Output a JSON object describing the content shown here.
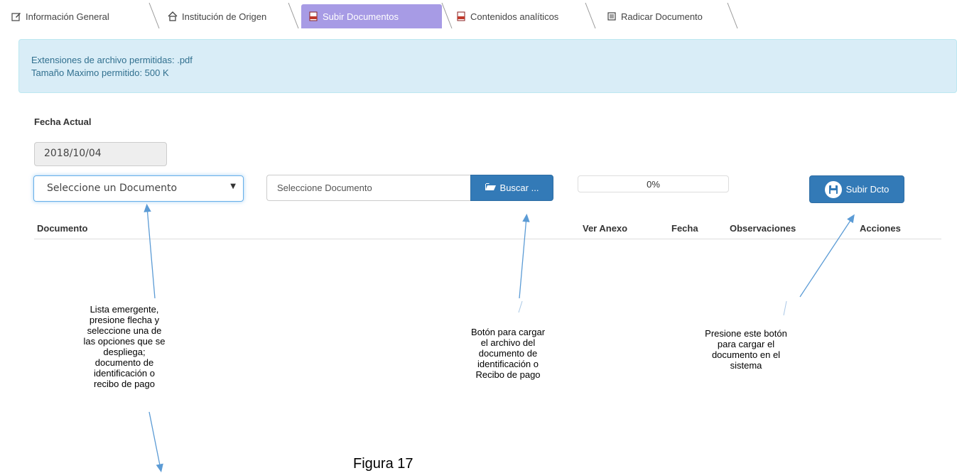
{
  "tabs": [
    {
      "label": "Información General",
      "icon": "edit-icon",
      "active": false
    },
    {
      "label": "Institución de Origen",
      "icon": "home-icon",
      "active": false
    },
    {
      "label": "Subir Documentos",
      "icon": "pdf-icon",
      "active": true
    },
    {
      "label": "Contenidos analíticos",
      "icon": "pdf-icon",
      "active": false
    },
    {
      "label": "Radicar Documento",
      "icon": "list-icon",
      "active": false
    }
  ],
  "alert": {
    "line1": "Extensiones de archivo permitidas: .pdf",
    "line2": "Tamaño Maximo permitido: 500 K"
  },
  "form": {
    "fecha_label": "Fecha Actual",
    "fecha_value": "2018/10/04",
    "select_value": "Seleccione un Documento",
    "file_placeholder": "Seleccione Documento",
    "buscar_label": "Buscar ...",
    "progress_value": 0,
    "progress_text": "0%",
    "subir_label": "Subir Dcto"
  },
  "table": {
    "headers": [
      "Documento",
      "Ver Anexo",
      "Fecha",
      "Observaciones",
      "Acciones"
    ]
  },
  "annotations": {
    "select_note": [
      "Lista emergente,",
      "presione flecha y",
      "seleccione una de",
      "las opciones que se",
      "despliega;",
      "documento de",
      "identificación o",
      "recibo de pago"
    ],
    "buscar_note": [
      "Botón para cargar",
      "el archivo del",
      "documento de",
      "identificación o",
      "Recibo de pago"
    ],
    "subir_note": [
      "Presione este botón",
      "para cargar el",
      "documento en el",
      "sistema"
    ]
  },
  "figure_caption": "Figura 17",
  "colors": {
    "active_tab": "#a79be5",
    "primary": "#337ab7",
    "alert_bg": "#d9edf7",
    "alert_text": "#31708f",
    "arrow": "#5b9bd5"
  }
}
